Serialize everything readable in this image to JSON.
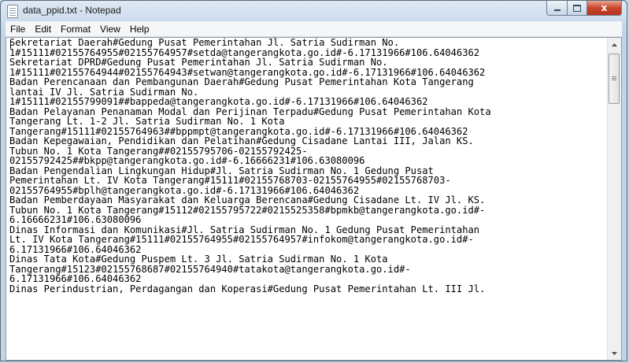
{
  "window": {
    "title": "data_ppid.txt - Notepad"
  },
  "controls": {
    "close_glyph": "x"
  },
  "menu": [
    "File",
    "Edit",
    "Format",
    "View",
    "Help"
  ],
  "editor": {
    "lines": [
      "Sekretariat Daerah#Gedung Pusat Pemerintahan Jl. Satria Sudirman No.",
      "1#15111#02155764955#02155764957#setda@tangerangkota.go.id#-6.17131966#106.64046362",
      "Sekretariat DPRD#Gedung Pusat Pemerintahan Jl. Satria Sudirman No.",
      "1#15111#02155764944#02155764943#setwan@tangerangkota.go.id#-6.17131966#106.64046362",
      "Badan Perencanaan dan Pembangunan Daerah#Gedung Pusat Pemerintahan Kota Tangerang",
      "lantai IV Jl. Satria Sudirman No.",
      "1#15111#02155799091##bappeda@tangerangkota.go.id#-6.17131966#106.64046362",
      "Badan Pelayanan Penanaman Modal dan Perijinan Terpadu#Gedung Pusat Pemerintahan Kota",
      "Tangerang Lt. 1-2 Jl. Satria Sudirman No. 1 Kota",
      "Tangerang#15111#02155764963##bppmpt@tangerangkota.go.id#-6.17131966#106.64046362",
      "Badan Kepegawaian, Pendidikan dan Pelatihan#Gedung Cisadane Lantai III, Jalan KS.",
      "Tubun No. 1 Kota Tangerang##02155795706-02155792425-",
      "02155792425##bkpp@tangerangkota.go.id#-6.16666231#106.63080096",
      "Badan Pengendalian Lingkungan Hidup#Jl. Satria Sudirman No. 1 Gedung Pusat",
      "Pemerintahan Lt. IV Kota Tangerang#15111#02155768703-02155764955#02155768703-",
      "02155764955#bplh@tangerangkota.go.id#-6.17131966#106.64046362",
      "Badan Pemberdayaan Masyarakat dan Keluarga Berencana#Gedung Cisadane Lt. IV Jl. KS.",
      "Tubun No. 1 Kota Tangerang#15112#02155795722#0215525358#bpmkb@tangerangkota.go.id#-",
      "6.16666231#106.63080096",
      "Dinas Informasi dan Komunikasi#Jl. Satria Sudirman No. 1 Gedung Pusat Pemerintahan",
      "Lt. IV Kota Tangerang#15111#02155764955#02155764957#infokom@tangerangkota.go.id#-",
      "6.17131966#106.64046362",
      "Dinas Tata Kota#Gedung Puspem Lt. 3 Jl. Satria Sudirman No. 1 Kota",
      "Tangerang#15123#02155768687#02155764940#tatakota@tangerangkota.go.id#-",
      "6.17131966#106.64046362",
      "Dinas Perindustrian, Perdagangan dan Koperasi#Gedung Pusat Pemerintahan Lt. III Jl."
    ]
  }
}
